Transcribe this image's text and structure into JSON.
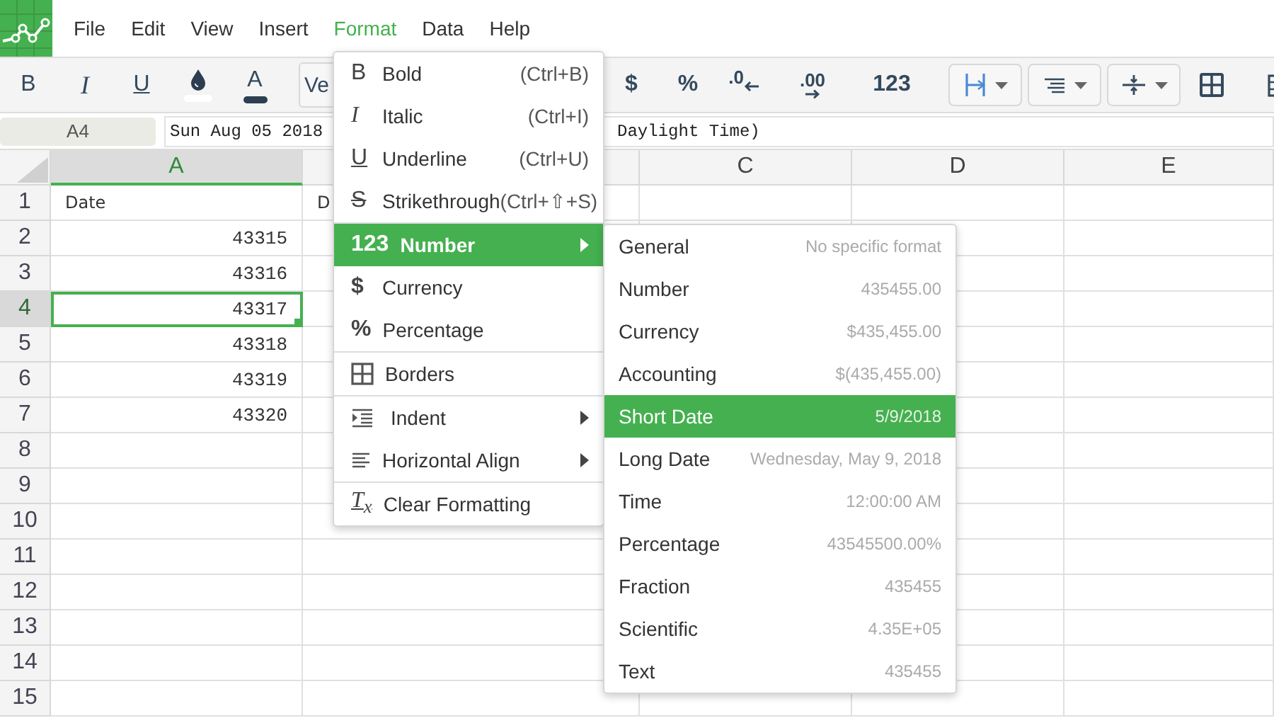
{
  "menu_bar": [
    {
      "label": "File",
      "selected": false
    },
    {
      "label": "Edit",
      "selected": false
    },
    {
      "label": "View",
      "selected": false
    },
    {
      "label": "Insert",
      "selected": false
    },
    {
      "label": "Format",
      "selected": true
    },
    {
      "label": "Data",
      "selected": false
    },
    {
      "label": "Help",
      "selected": false
    }
  ],
  "toolbar": {
    "groups": [
      [
        {
          "kind": "glyph",
          "text": "B"
        },
        {
          "kind": "glyph",
          "text": "I"
        },
        {
          "kind": "glyph",
          "text": "U"
        },
        {
          "kind": "icon"
        },
        {
          "kind": "glyph",
          "text": "A"
        }
      ],
      [
        {
          "kind": "select",
          "text": "Ve"
        }
      ],
      [
        {
          "kind": "glyph",
          "text": "$"
        },
        {
          "kind": "glyph",
          "text": "%"
        },
        {
          "kind": "glyph",
          "text": ".0"
        },
        {
          "kind": "glyph",
          "text": ".00"
        },
        {
          "kind": "glyph",
          "text": "123"
        }
      ],
      [
        {
          "kind": "dropdown"
        },
        {
          "kind": "dropdown"
        },
        {
          "kind": "dropdown"
        },
        {
          "kind": "icon"
        }
      ],
      [
        {
          "kind": "icon"
        }
      ]
    ]
  },
  "formula_bar": {
    "cell_ref": "A4",
    "value_start": "Sun Aug 05 2018",
    "value_end": "Daylight Time)"
  },
  "sheet": {
    "columns": [
      {
        "label": "A",
        "selected": true
      },
      {
        "selected": false
      },
      {
        "label": "C",
        "selected": false
      },
      {
        "label": "D",
        "selected": false
      },
      {
        "label": "E",
        "selected": false
      }
    ],
    "rows": [
      {
        "label": "1",
        "selected": false,
        "cells": [
          {
            "text": "Date",
            "kind": "text",
            "selected": false
          },
          {
            "text": "D",
            "kind": "text",
            "selected": false
          }
        ]
      },
      {
        "label": "2",
        "selected": false,
        "cells": [
          {
            "text": "43315",
            "kind": "number",
            "selected": false
          }
        ]
      },
      {
        "label": "3",
        "selected": false,
        "cells": [
          {
            "text": "43316",
            "kind": "number",
            "selected": false
          }
        ]
      },
      {
        "label": "4",
        "selected": true,
        "cells": [
          {
            "text": "43317",
            "kind": "number",
            "selected": true
          }
        ]
      },
      {
        "label": "5",
        "selected": false,
        "cells": [
          {
            "text": "43318",
            "kind": "number",
            "selected": false
          }
        ]
      },
      {
        "label": "6",
        "selected": false,
        "cells": [
          {
            "text": "43319",
            "kind": "number",
            "selected": false
          }
        ]
      },
      {
        "label": "7",
        "selected": false,
        "cells": [
          {
            "text": "43320",
            "kind": "number",
            "selected": false
          }
        ]
      },
      {
        "label": "8",
        "selected": false,
        "cells": []
      },
      {
        "label": "9",
        "selected": false,
        "cells": []
      },
      {
        "label": "10",
        "selected": false,
        "cells": []
      },
      {
        "label": "11",
        "selected": false,
        "cells": []
      },
      {
        "label": "12",
        "selected": false,
        "cells": []
      },
      {
        "label": "13",
        "selected": false,
        "cells": []
      },
      {
        "label": "14",
        "selected": false,
        "cells": []
      },
      {
        "label": "15",
        "selected": false,
        "cells": []
      }
    ]
  },
  "format_menu": {
    "groups": [
      [
        {
          "glyph": "B",
          "label": "Bold",
          "shortcut": "(Ctrl+B)",
          "submenu": false,
          "selected": false
        },
        {
          "glyph": "I",
          "label": "Italic",
          "shortcut": "(Ctrl+I)",
          "submenu": false,
          "selected": false
        },
        {
          "glyph": "U",
          "label": "Underline",
          "shortcut": "(Ctrl+U)",
          "submenu": false,
          "selected": false
        },
        {
          "glyph": "S",
          "label": "Strikethrough",
          "shortcut": "(Ctrl+⇧+S)",
          "submenu": false,
          "selected": false
        }
      ],
      [
        {
          "glyph": "123",
          "label": "Number",
          "submenu": true,
          "selected": true
        },
        {
          "glyph": "$",
          "label": "Currency",
          "submenu": false,
          "selected": false
        },
        {
          "glyph": "%",
          "label": "Percentage",
          "submenu": false,
          "selected": false
        }
      ],
      [
        {
          "label": "Borders",
          "submenu": false,
          "selected": false
        }
      ],
      [
        {
          "label": "Indent",
          "submenu": true,
          "selected": false
        },
        {
          "label": "Horizontal Align",
          "submenu": true,
          "selected": false
        }
      ],
      [
        {
          "glyph": "T$_{x}$",
          "label": "Clear Formatting",
          "submenu": false,
          "selected": false
        }
      ]
    ]
  },
  "number_submenu": [
    {
      "label": "General",
      "hint": "No specific format",
      "selected": false
    },
    {
      "label": "Number",
      "hint": "435455.00",
      "selected": false
    },
    {
      "label": "Currency",
      "hint": "$435,455.00",
      "selected": false
    },
    {
      "label": "Accounting",
      "hint": "$(435,455.00)",
      "selected": false
    },
    {
      "label": "Short Date",
      "hint": "5/9/2018",
      "selected": true
    },
    {
      "label": "Long Date",
      "hint": "Wednesday, May 9, 2018",
      "selected": false
    },
    {
      "label": "Time",
      "hint": "12:00:00 AM",
      "selected": false
    },
    {
      "label": "Percentage",
      "hint": "43545500.00%",
      "selected": false
    },
    {
      "label": "Fraction",
      "hint": "435455",
      "selected": false
    },
    {
      "label": "Scientific",
      "hint": "4.35E+05",
      "selected": false
    },
    {
      "label": "Text",
      "hint": "435455",
      "selected": false
    }
  ]
}
